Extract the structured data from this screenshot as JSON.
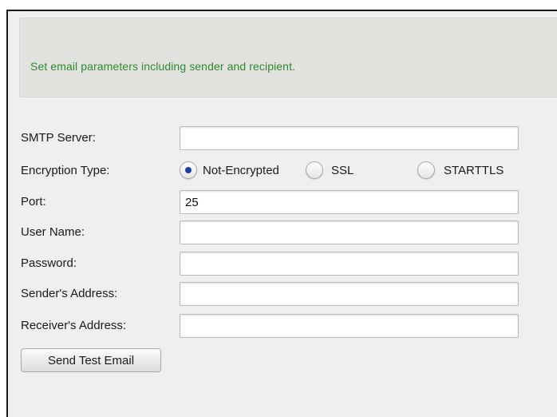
{
  "banner": {
    "text": "Set email parameters including sender and recipient."
  },
  "form": {
    "smtp_server": {
      "label": "SMTP Server:",
      "value": ""
    },
    "encryption": {
      "label": "Encryption Type:",
      "options": [
        "Not-Encrypted",
        "SSL",
        "STARTTLS"
      ],
      "selected": "Not-Encrypted"
    },
    "port": {
      "label": "Port:",
      "value": "25"
    },
    "user_name": {
      "label": "User Name:",
      "value": ""
    },
    "password": {
      "label": "Password:",
      "value": ""
    },
    "sender_address": {
      "label": "Sender's Address:",
      "value": ""
    },
    "receiver_address": {
      "label": "Receiver's Address:",
      "value": ""
    }
  },
  "actions": {
    "send_test_label": "Send Test Email"
  },
  "colors": {
    "banner_text": "#2f8a2f",
    "radio_selected": "#1f3fa8"
  }
}
